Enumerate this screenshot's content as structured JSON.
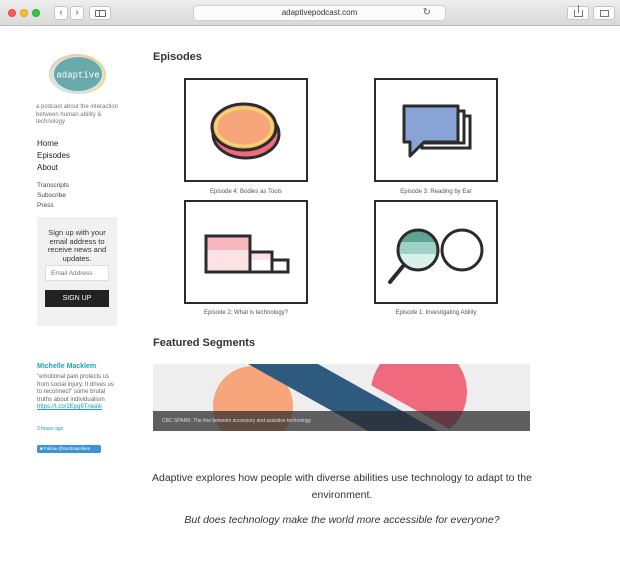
{
  "browser": {
    "url": "adaptivepodcast.com",
    "back_glyph": "‹",
    "forward_glyph": "›",
    "reload_glyph": "↻"
  },
  "sidebar": {
    "logo_text": "adaptive",
    "tagline": "a podcast about the interaction between human ability & technology",
    "nav_main": [
      "Home",
      "Episodes",
      "About"
    ],
    "nav_sub": [
      "Transcripts",
      "Subscribe",
      "Press"
    ],
    "signup": {
      "text": "Sign up with your email address to receive news and updates.",
      "email_placeholder": "Email Address",
      "button_label": "SIGN UP"
    },
    "twitter": {
      "name": "Michelle Macklem",
      "text": "\"emotional pain protects us from social injury. It drives us to reconnect\" some brutal truths about individualism",
      "link": "https://t.co/2Epg6Tnea\\k",
      "time": "3 hours ago",
      "follow_label": "Follow @michmacklem"
    }
  },
  "main": {
    "episodes_heading": "Episodes",
    "episodes": [
      "Episode 4: Bodies as Tools",
      "Episode 3: Reading by Ear",
      "Episode 2: What is technology?",
      "Episode 1: Investigating Ability"
    ],
    "featured_heading": "Featured Segments",
    "featured_caption": "CBC SPARK: The line between accessory and assistive technology",
    "description": "Adaptive explores how people with diverse abilities use technology to adapt to the environment.",
    "question": "But does technology make the world more accessible for everyone?"
  },
  "colors": {
    "accent_teal": "#1aa3b0",
    "salmon": "#f7a57b",
    "pink": "#f06a7e",
    "navy": "#2f5a80",
    "blue_periwinkle": "#8aa3d6",
    "green_teal": "#5fa394"
  }
}
